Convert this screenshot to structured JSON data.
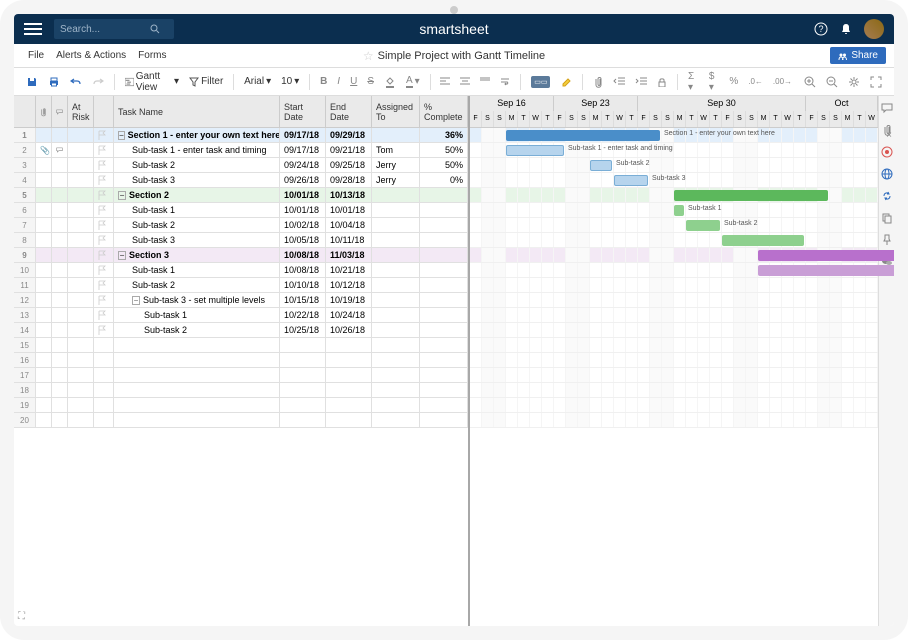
{
  "search": {
    "placeholder": "Search..."
  },
  "brand": "smartsheet",
  "menus": {
    "file": "File",
    "alerts": "Alerts & Actions",
    "forms": "Forms"
  },
  "doc_title": "Simple Project with Gantt Timeline",
  "share_label": "Share",
  "toolbar": {
    "view": "Gantt View",
    "filter": "Filter",
    "font": "Arial",
    "size": "10"
  },
  "columns": {
    "risk": "At Risk",
    "task": "Task Name",
    "start": "Start Date",
    "end": "End Date",
    "assigned": "Assigned To",
    "pct": "% Complete"
  },
  "timeline": {
    "groups": [
      {
        "label": "Sep 16",
        "days": [
          "F",
          "S",
          "S",
          "M",
          "T",
          "W",
          "T"
        ]
      },
      {
        "label": "Sep 23",
        "days": [
          "F",
          "S",
          "S",
          "M",
          "T",
          "W",
          "T"
        ]
      },
      {
        "label": "Sep 30",
        "days": [
          "F",
          "S",
          "S",
          "M",
          "T",
          "W",
          "T",
          "F",
          "S",
          "S",
          "M",
          "T",
          "W",
          "T"
        ]
      },
      {
        "label": "Oct",
        "days": [
          "F",
          "S",
          "S",
          "M",
          "T",
          "W"
        ]
      }
    ],
    "origin": "2018-09-14"
  },
  "rows": [
    {
      "num": 1,
      "section": true,
      "color": "blue",
      "indent": 0,
      "task": "Section 1 - enter your own text here",
      "start": "09/17/18",
      "end": "09/29/18",
      "pct": "36%",
      "bar_start": 3,
      "bar_len": 13,
      "bar_style": "blueh",
      "label_out": "Section 1 - enter your own text here"
    },
    {
      "num": 2,
      "attach": true,
      "indent": 1,
      "task": "Sub-task 1 - enter task and timing",
      "start": "09/17/18",
      "end": "09/21/18",
      "assigned": "Tom",
      "pct": "50%",
      "bar_start": 3,
      "bar_len": 5,
      "bar_style": "blue",
      "label_out": "Sub-task 1 - enter task and timing"
    },
    {
      "num": 3,
      "indent": 1,
      "task": "Sub-task 2",
      "start": "09/24/18",
      "end": "09/25/18",
      "assigned": "Jerry",
      "pct": "50%",
      "bar_start": 10,
      "bar_len": 2,
      "bar_style": "blue",
      "label_out": "Sub-task 2"
    },
    {
      "num": 4,
      "indent": 1,
      "task": "Sub-task 3",
      "start": "09/26/18",
      "end": "09/28/18",
      "assigned": "Jerry",
      "pct": "0%",
      "bar_start": 12,
      "bar_len": 3,
      "bar_style": "blue",
      "label_out": "Sub-task 3"
    },
    {
      "num": 5,
      "section": true,
      "color": "green",
      "indent": 0,
      "task": "Section 2",
      "start": "10/01/18",
      "end": "10/13/18",
      "bar_start": 17,
      "bar_len": 13,
      "bar_style": "greenh"
    },
    {
      "num": 6,
      "indent": 1,
      "task": "Sub-task 1",
      "start": "10/01/18",
      "end": "10/01/18",
      "bar_start": 17,
      "bar_len": 1,
      "bar_style": "green",
      "label_out": "Sub-task 1"
    },
    {
      "num": 7,
      "indent": 1,
      "task": "Sub-task 2",
      "start": "10/02/18",
      "end": "10/04/18",
      "bar_start": 18,
      "bar_len": 3,
      "bar_style": "green",
      "label_out": "Sub-task 2"
    },
    {
      "num": 8,
      "indent": 1,
      "task": "Sub-task 3",
      "start": "10/05/18",
      "end": "10/11/18",
      "bar_start": 21,
      "bar_len": 7,
      "bar_style": "green"
    },
    {
      "num": 9,
      "section": true,
      "color": "purple",
      "indent": 0,
      "task": "Section 3",
      "start": "10/08/18",
      "end": "11/03/18",
      "bar_start": 24,
      "bar_len": 27,
      "bar_style": "purpleh"
    },
    {
      "num": 10,
      "indent": 1,
      "task": "Sub-task 1",
      "start": "10/08/18",
      "end": "10/21/18",
      "bar_start": 24,
      "bar_len": 14,
      "bar_style": "purple"
    },
    {
      "num": 11,
      "indent": 1,
      "task": "Sub-task 2",
      "start": "10/10/18",
      "end": "10/12/18"
    },
    {
      "num": 12,
      "indent": 1,
      "has_collapse": true,
      "task": "Sub-task 3 - set multiple levels",
      "start": "10/15/18",
      "end": "10/19/18"
    },
    {
      "num": 13,
      "indent": 2,
      "task": "Sub-task 1",
      "start": "10/22/18",
      "end": "10/24/18"
    },
    {
      "num": 14,
      "indent": 2,
      "task": "Sub-task 2",
      "start": "10/25/18",
      "end": "10/26/18"
    },
    {
      "num": 15
    },
    {
      "num": 16
    },
    {
      "num": 17
    },
    {
      "num": 18
    },
    {
      "num": 19
    },
    {
      "num": 20
    }
  ]
}
